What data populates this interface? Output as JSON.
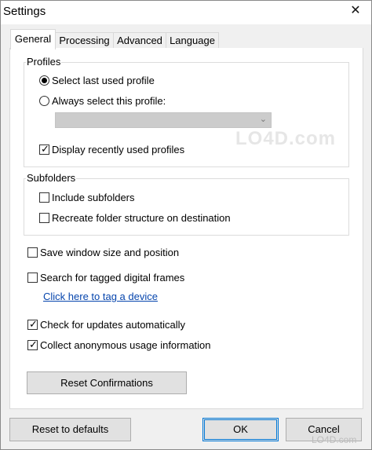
{
  "window": {
    "title": "Settings",
    "close_glyph": "✕"
  },
  "tabs": [
    {
      "label": "General",
      "active": true
    },
    {
      "label": "Processing",
      "active": false
    },
    {
      "label": "Advanced",
      "active": false
    },
    {
      "label": "Language",
      "active": false
    }
  ],
  "profiles": {
    "group_label": "Profiles",
    "radio_last_used": {
      "label": "Select last used profile",
      "checked": true
    },
    "radio_always": {
      "label": "Always select this profile:",
      "checked": false
    },
    "profile_dropdown": {
      "value": "",
      "chevron": "⌄"
    },
    "display_recent": {
      "label": "Display recently used profiles",
      "checked": true
    }
  },
  "subfolders": {
    "group_label": "Subfolders",
    "include": {
      "label": "Include subfolders",
      "checked": false
    },
    "recreate": {
      "label": "Recreate folder structure on destination",
      "checked": false
    }
  },
  "options": {
    "save_window": {
      "label": "Save window size and position",
      "checked": false
    },
    "search_tagged": {
      "label": "Search for tagged digital frames",
      "checked": false
    },
    "tag_device_link": "Click here to tag a device",
    "check_updates": {
      "label": "Check for updates automatically",
      "checked": true
    },
    "collect_usage": {
      "label": "Collect anonymous usage information",
      "checked": true
    }
  },
  "buttons": {
    "reset_confirmations": "Reset Confirmations",
    "reset_defaults": "Reset to defaults",
    "ok": "OK",
    "cancel": "Cancel"
  },
  "watermark": {
    "text": "LO4D.com",
    "bottom_text": "LO4D.com"
  }
}
